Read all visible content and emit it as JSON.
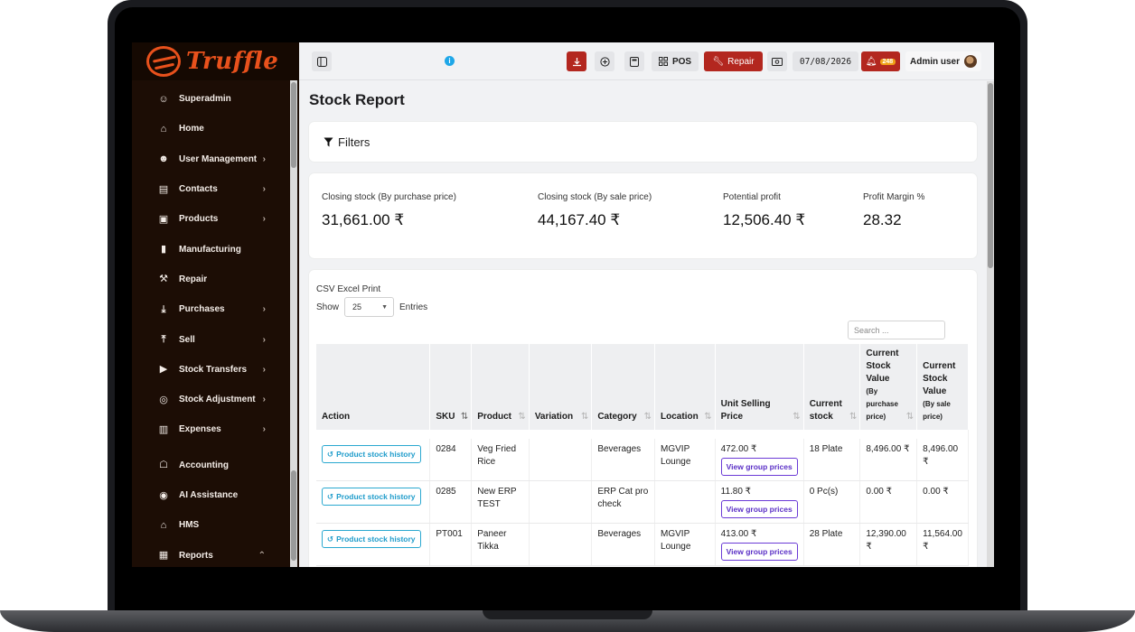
{
  "app": {
    "brand": "Truffle",
    "brand_color": "#e8511c",
    "accent_red": "#b3271f"
  },
  "sidebar": {
    "items": [
      {
        "label": "Superadmin",
        "icon": "user-icon",
        "chevron": false
      },
      {
        "label": "Home",
        "icon": "home-icon",
        "chevron": false
      },
      {
        "label": "User Management",
        "icon": "users-icon",
        "chevron": true
      },
      {
        "label": "Contacts",
        "icon": "contacts-icon",
        "chevron": true
      },
      {
        "label": "Products",
        "icon": "box-icon",
        "chevron": true
      },
      {
        "label": "Manufacturing",
        "icon": "factory-icon",
        "chevron": false
      },
      {
        "label": "Repair",
        "icon": "wrench-icon",
        "chevron": false
      },
      {
        "label": "Purchases",
        "icon": "download-icon",
        "chevron": true
      },
      {
        "label": "Sell",
        "icon": "upload-icon",
        "chevron": true
      },
      {
        "label": "Stock Transfers",
        "icon": "truck-icon",
        "chevron": true
      },
      {
        "label": "Stock Adjustment",
        "icon": "database-icon",
        "chevron": true
      },
      {
        "label": "Expenses",
        "icon": "receipt-icon",
        "chevron": true
      },
      {
        "label": "Accounting",
        "icon": "bank-icon",
        "chevron": false
      },
      {
        "label": "AI Assistance",
        "icon": "robot-icon",
        "chevron": false
      },
      {
        "label": "HMS",
        "icon": "hotel-icon",
        "chevron": false
      },
      {
        "label": "Reports",
        "icon": "report-icon",
        "chevron": true
      }
    ]
  },
  "topbar": {
    "pos_label": "POS",
    "repair_label": "Repair",
    "date": "07/08/2026",
    "notification_count": "248",
    "user_label": "Admin user",
    "info_glyph": "i"
  },
  "page": {
    "title": "Stock Report",
    "filters_label": "Filters"
  },
  "summary": [
    {
      "label": "Closing stock (By purchase price)",
      "value": "31,661.00 ₹"
    },
    {
      "label": "Closing stock (By sale price)",
      "value": "44,167.40 ₹"
    },
    {
      "label": "Potential profit",
      "value": "12,506.40 ₹"
    },
    {
      "label": "Profit Margin %",
      "value": "28.32"
    }
  ],
  "table_controls": {
    "export_label": "CSV Excel Print",
    "show_label": "Show",
    "entries_value": "25",
    "entries_label": "Entries",
    "search_placeholder": "Search ..."
  },
  "table": {
    "headers": {
      "action": "Action",
      "sku": "SKU",
      "product": "Product",
      "variation": "Variation",
      "category": "Category",
      "location": "Location",
      "unit_price": "Unit Selling Price",
      "current_stock": "Current stock",
      "value_purchase": "Current Stock Value",
      "value_purchase_sub": "(By purchase price)",
      "value_sale": "Current Stock Value",
      "value_sale_sub": "(By sale price)"
    },
    "history_button": "Product stock history",
    "group_prices_button": "View group prices",
    "rows": [
      {
        "sku": "0284",
        "product": "Veg Fried Rice",
        "variation": "",
        "category": "Beverages",
        "location": "MGVIP Lounge",
        "price": "472.00 ₹",
        "stock": "18 Plate",
        "value_purchase": "8,496.00 ₹",
        "value_sale": "8,496.00 ₹"
      },
      {
        "sku": "0285",
        "product": "New ERP TEST",
        "variation": "",
        "category": "ERP Cat pro check",
        "location": "",
        "price": "11.80 ₹",
        "stock": "0 Pc(s)",
        "value_purchase": "0.00 ₹",
        "value_sale": "0.00 ₹"
      },
      {
        "sku": "PT001",
        "product": "Paneer Tikka",
        "variation": "",
        "category": "Beverages",
        "location": "MGVIP Lounge",
        "price": "413.00 ₹",
        "stock": "28 Plate",
        "value_purchase": "12,390.00 ₹",
        "value_sale": "11,564.00 ₹"
      }
    ]
  }
}
